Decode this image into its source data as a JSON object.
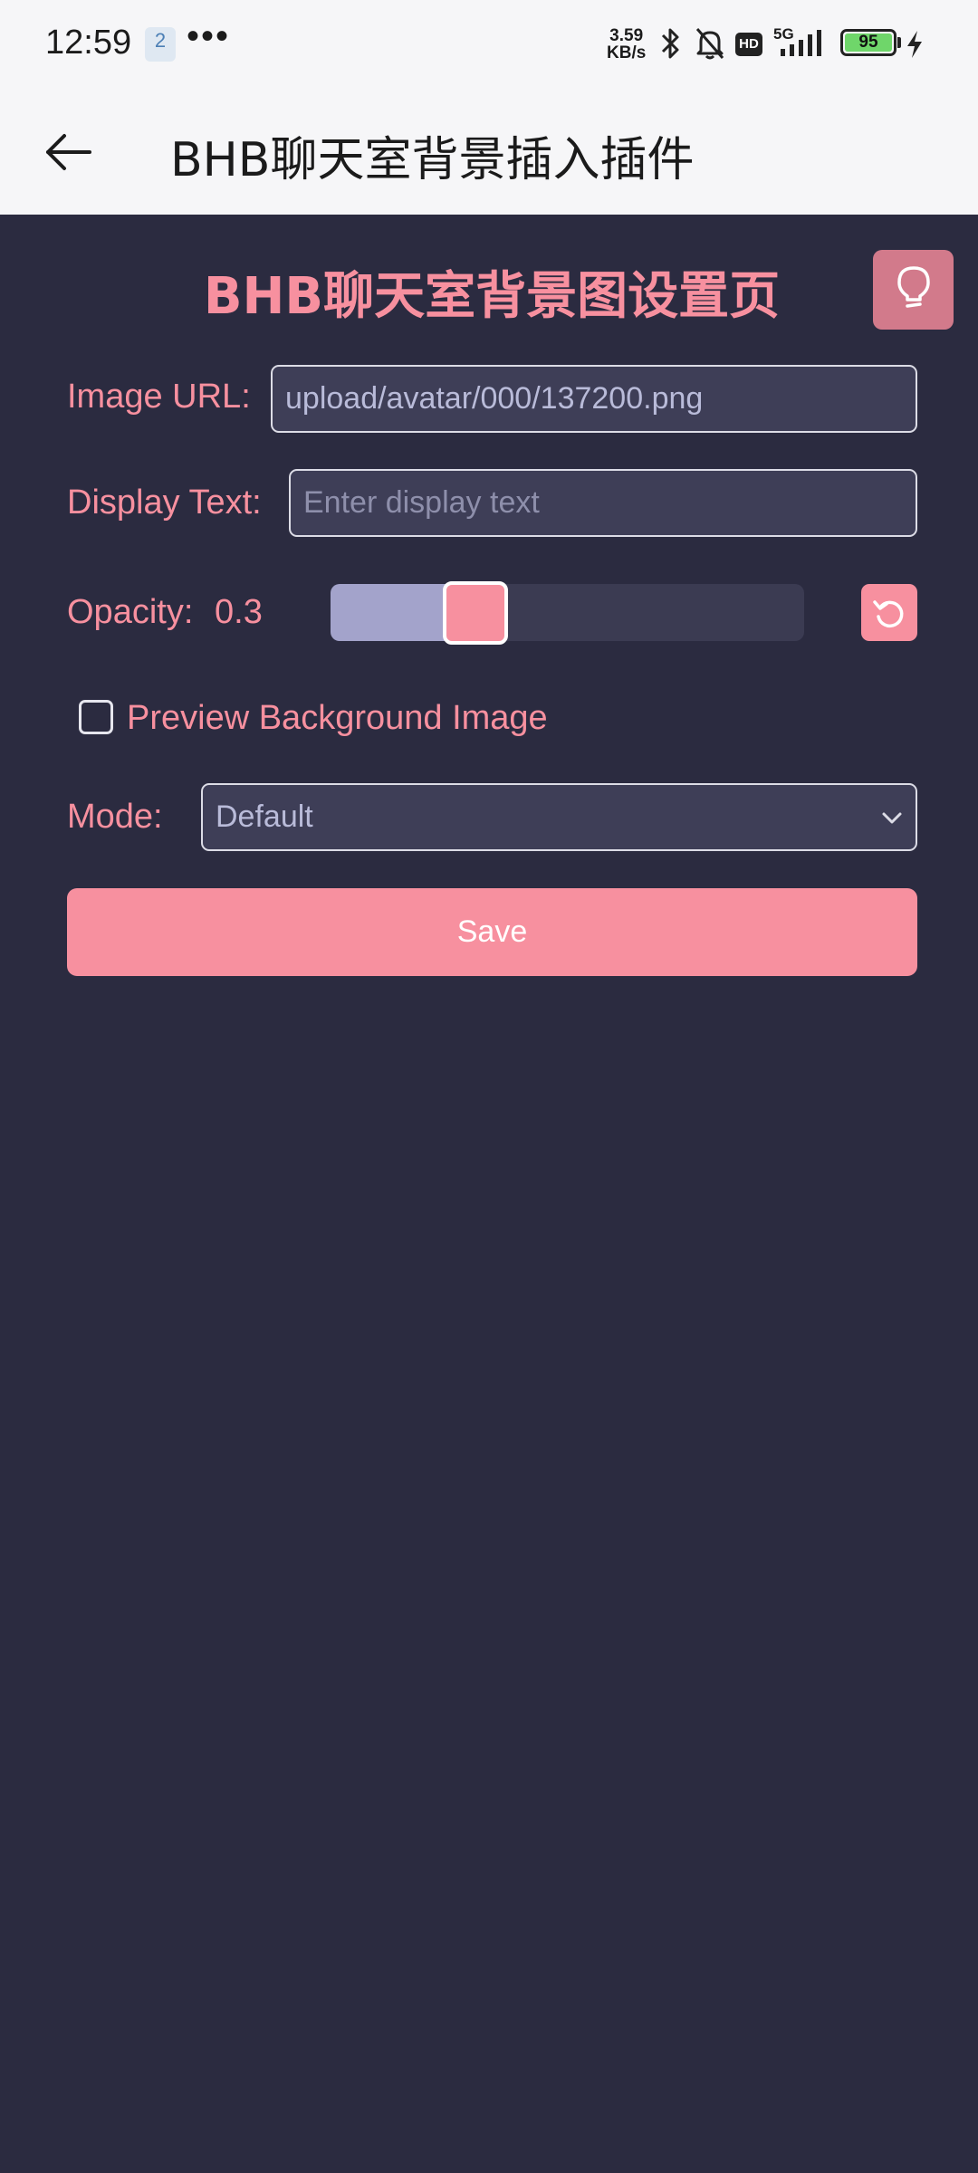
{
  "status_bar": {
    "time": "12:59",
    "notification_badge": "2",
    "overflow_dots": "•••",
    "net_speed_value": "3.59",
    "net_speed_unit": "KB/s",
    "hd_label": "HD",
    "network_type": "5G",
    "battery_level": "95",
    "battery_color": "#6fd66a"
  },
  "app_bar": {
    "title": "BHB聊天室背景插入插件",
    "back_icon": "arrow-left-icon"
  },
  "page": {
    "heading": "BHB聊天室背景图设置页",
    "theme_icon": "lightbulb-icon"
  },
  "form": {
    "image_url_label": "Image URL:",
    "image_url_value": "upload/avatar/000/137200.png",
    "display_text_label": "Display Text:",
    "display_text_placeholder": "Enter display text",
    "display_text_value": "",
    "opacity_label": "Opacity:",
    "opacity_value": "0.3",
    "opacity_fraction": 0.3,
    "reset_icon": "undo-icon",
    "preview_label": "Preview Background Image",
    "preview_checked": false,
    "mode_label": "Mode:",
    "mode_value": "Default",
    "save_label": "Save"
  },
  "colors": {
    "accent": "#f7909f",
    "background": "#2b2b40",
    "input_bg": "#3e3e57",
    "slider_fill": "#a3a3cb"
  }
}
